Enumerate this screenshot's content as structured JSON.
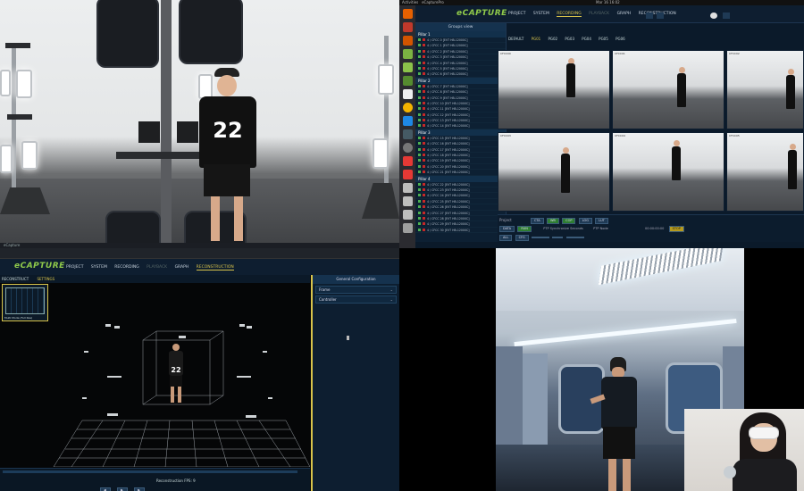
{
  "ecapture": {
    "os_bar": {
      "left": "Activities",
      "app": "eCapturePro",
      "clock": "Mar 16 16:02"
    },
    "brand": "eCAPTURE",
    "nav": [
      "PROJECT",
      "SYSTEM",
      "RECORDING",
      "PLAYBACK",
      "GRAPH",
      "RECONSTRUCTION"
    ],
    "nav_active": "RECORDING",
    "sidebar_title": "Groups view",
    "groups": [
      {
        "label": "Pillar 1",
        "cams": [
          "4 / CFCC 0 [EVT HB-12000C]",
          "4 / CFCC 1 [EVT HB-12000C]",
          "4 / CFCC 2 [EVT HB-12000C]",
          "4 / CFCC 3 [EVT HB-12000C]",
          "4 / CFCC 4 [EVT HB-12000C]",
          "4 / CFCC 5 [EVT HB-12000C]",
          "4 / CFCC 6 [EVT HB-12000C]"
        ]
      },
      {
        "label": "Pillar 2",
        "cams": [
          "4 / CFCC 7 [EVT HB-12000C]",
          "4 / CFCC 8 [EVT HB-12000C]",
          "4 / CFCC 9 [EVT HB-12000C]",
          "4 / CFCC 10 [EVT HB-12000C]",
          "4 / CFCC 11 [EVT HB-12000C]",
          "4 / CFCC 12 [EVT HB-12000C]",
          "4 / CFCC 13 [EVT HB-12000C]",
          "4 / CFCC 14 [EVT HB-12000C]"
        ]
      },
      {
        "label": "Pillar 3",
        "cams": [
          "4 / CFCC 15 [EVT HB-12000C]",
          "4 / CFCC 16 [EVT HB-12000C]",
          "4 / CFCC 17 [EVT HB-12000C]",
          "4 / CFCC 18 [EVT HB-12000C]",
          "4 / CFCC 19 [EVT HB-12000C]",
          "4 / CFCC 20 [EVT HB-12000C]",
          "4 / CFCC 21 [EVT HB-12000C]"
        ]
      },
      {
        "label": "Pillar 4",
        "cams": [
          "4 / CFCC 22 [EVT HB-12000C]",
          "4 / CFCC 23 [EVT HB-12000C]",
          "4 / CFCC 24 [EVT HB-12000C]",
          "4 / CFCC 25 [EVT HB-12000C]",
          "4 / CFCC 26 [EVT HB-12000C]",
          "4 / CFCC 27 [EVT HB-12000C]",
          "4 / CFCC 28 [EVT HB-12000C]",
          "4 / CFCC 29 [EVT HB-12000C]",
          "4 / CFCC 30 [EVT HB-12000C]"
        ]
      }
    ],
    "view_tabs": [
      "DEFAULT",
      "PG01",
      "PG02",
      "PG03",
      "PG04",
      "PG05",
      "PG06"
    ],
    "view_tab_active": "PG01",
    "tile_labels": [
      "CFCC00",
      "CFCC01",
      "CFCC02",
      "CFCC03",
      "CFCC04",
      "CFCC05"
    ],
    "controls": {
      "project_label": "Project",
      "buttons_row1": [
        "CTA",
        "WB",
        "COP",
        "LOG",
        "LUT"
      ],
      "ptp_label": "PTP Synchronize Seconds",
      "ptp_node_label": "PTP Node",
      "timecode": "00:00:00:00",
      "stop": "STOP",
      "row2": [
        "DATA",
        "RUN",
        "ALL",
        "CFG"
      ]
    }
  },
  "recon": {
    "nav": [
      "PROJECT",
      "SYSTEM",
      "RECORDING",
      "PLAYBACK",
      "GRAPH",
      "RECONSTRUCTION"
    ],
    "nav_active": "RECONSTRUCTION",
    "subtabs": [
      "RECONSTRUCT",
      "SETTINGS"
    ],
    "subtab_active": "SETTINGS",
    "thumb_caption": "Multi Mode (Full Res)",
    "panel_title": "General Configuration",
    "panel_rows": [
      "Frame",
      "Controller"
    ],
    "timeline_label": "Reconstruction FPS: 9",
    "jersey_number": "22"
  },
  "studio": {
    "jersey_number": "22",
    "statusbar": "eCapture"
  },
  "colors": {
    "accent": "#d8c34a",
    "brand_green": "#8fc94a",
    "ui_dark": "#0b1a2a"
  }
}
